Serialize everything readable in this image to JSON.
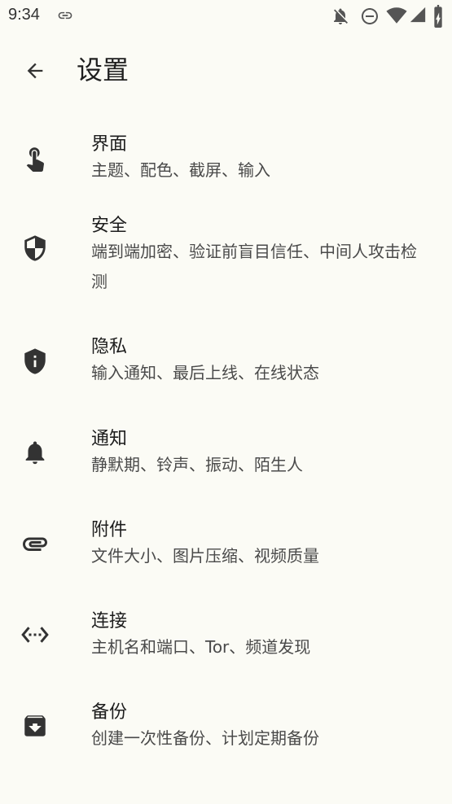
{
  "status_bar": {
    "time": "9:34",
    "icons": [
      "link-icon",
      "notifications-off-icon",
      "do-not-disturb-icon",
      "wifi-icon",
      "cell-signal-icon",
      "battery-charging-icon"
    ]
  },
  "app_bar": {
    "back_icon": "arrow-back-icon",
    "title": "设置"
  },
  "settings": {
    "items": [
      {
        "icon": "touch-app-icon",
        "title": "界面",
        "summary": "主题、配色、截屏、输入"
      },
      {
        "icon": "shield-icon",
        "title": "安全",
        "summary": "端到端加密、验证前盲目信任、中间人攻击检测"
      },
      {
        "icon": "privacy-info-icon",
        "title": "隐私",
        "summary": "输入通知、最后上线、在线状态"
      },
      {
        "icon": "bell-icon",
        "title": "通知",
        "summary": "静默期、铃声、振动、陌生人"
      },
      {
        "icon": "attachment-icon",
        "title": "附件",
        "summary": "文件大小、图片压缩、视频质量"
      },
      {
        "icon": "settings-ethernet-icon",
        "title": "连接",
        "summary": "主机名和端口、Tor、频道发现"
      },
      {
        "icon": "archive-icon",
        "title": "备份",
        "summary": "创建一次性备份、计划定期备份"
      }
    ]
  },
  "colors": {
    "background": "#fbfbf5",
    "text_primary": "#1d1d1d",
    "text_secondary": "#4a4a4a",
    "icon": "#333333"
  }
}
